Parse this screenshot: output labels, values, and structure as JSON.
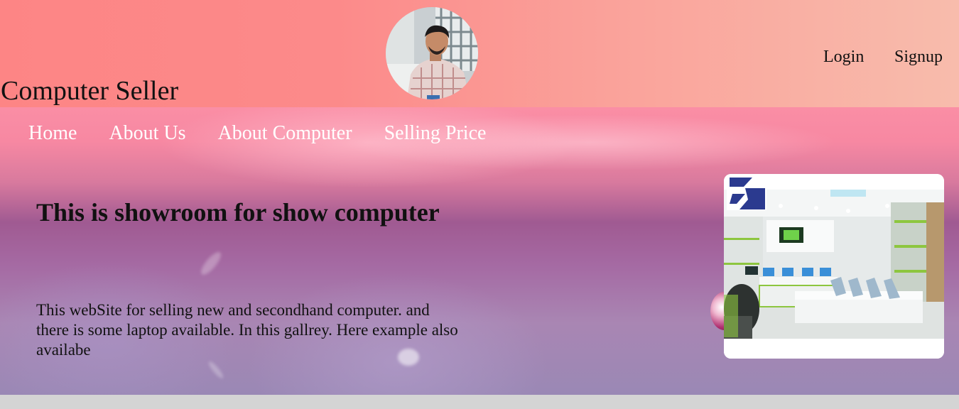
{
  "header": {
    "brand": "Computer Seller",
    "login_label": "Login",
    "signup_label": "Signup"
  },
  "nav": {
    "items": [
      {
        "label": "Home"
      },
      {
        "label": "About Us"
      },
      {
        "label": "About Computer"
      },
      {
        "label": "Selling Price"
      }
    ]
  },
  "hero": {
    "title": "This is showroom for show computer",
    "description": "This webSite for selling new and secondhand computer. and there is some laptop available. In this gallrey. Here example also availabe"
  },
  "colors": {
    "header_start": "#fd8585",
    "header_end": "#f8bcac",
    "nav_text": "#ffffff",
    "text": "#111111",
    "footer_bar": "#d4d4d4"
  }
}
